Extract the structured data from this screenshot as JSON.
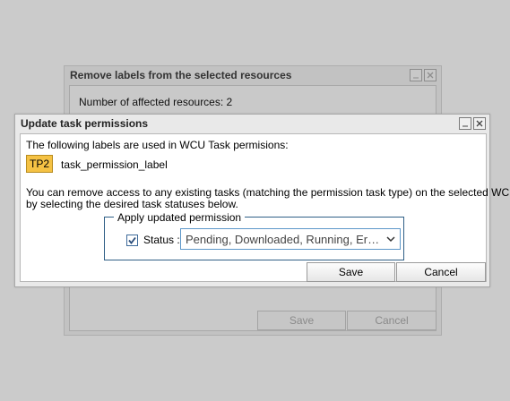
{
  "background_dialog": {
    "title": "Remove labels from the selected resources",
    "affected_text": "Number of affected resources: 2",
    "save_label": "Save",
    "cancel_label": "Cancel"
  },
  "dialog": {
    "title": "Update task permissions",
    "intro_text": "The following labels are used in WCU Task permisions:",
    "tag": {
      "code": "TP2",
      "name": "task_permission_label",
      "color": "#f5c244"
    },
    "description_line1": "You can remove access to any existing tasks (matching the permission task type) on the selected WCUs",
    "description_line2": "by selecting the desired task statuses below.",
    "fieldset_legend": "Apply updated permission",
    "status_label": "Status :",
    "status_checked": true,
    "status_value": "Pending, Downloaded, Running, Error, Pending Approval",
    "save_label": "Save",
    "cancel_label": "Cancel"
  },
  "colors": {
    "accent": "#2f5f86",
    "tag": "#f5c244",
    "select_border": "#5c97c9"
  }
}
